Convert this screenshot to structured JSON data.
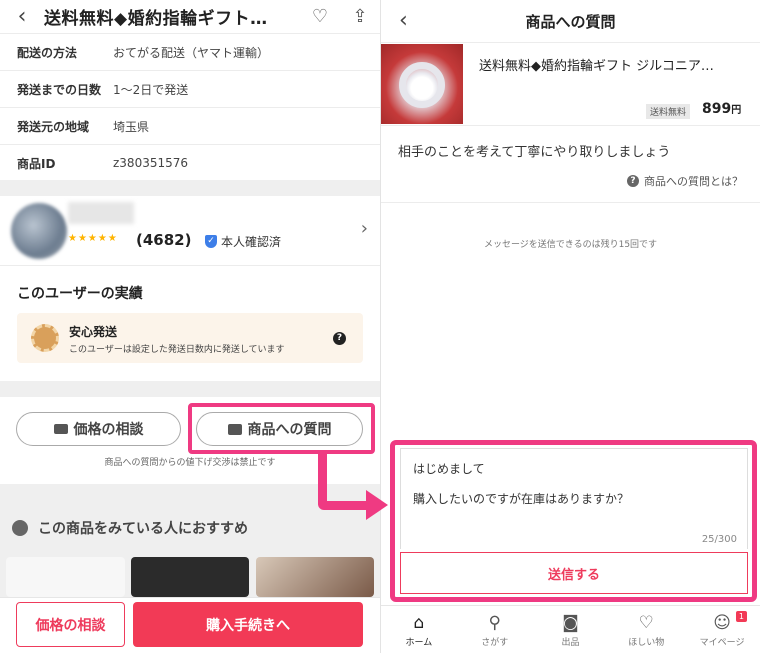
{
  "left": {
    "header_title": "送料無料◆婚約指輪ギフト…",
    "back_icon": "chevron-left-icon",
    "info_rows": [
      {
        "key": "配送の方法",
        "value": "おてがる配送（ヤマト運輸）"
      },
      {
        "key": "発送までの日数",
        "value": "1〜2日で発送"
      },
      {
        "key": "発送元の地域",
        "value": "埼玉県"
      },
      {
        "key": "商品ID",
        "value": "z380351576"
      }
    ],
    "seller": {
      "stars": "★★★★★",
      "rating_count": "(4682)",
      "verified": "本人確認済"
    },
    "performance": {
      "title": "このユーザーの実績",
      "main": "安心発送",
      "sub": "このユーザーは設定した発送日数内に発送しています"
    },
    "actions": {
      "price_negotiation": "価格の相談",
      "question": "商品への質問",
      "note": "商品への質問からの値下げ交渉は禁止です"
    },
    "recommend_title": "この商品をみている人におすすめ",
    "bottom": {
      "price_btn": "価格の相談",
      "buy_btn": "購入手続きへ"
    }
  },
  "right": {
    "header_title": "商品への質問",
    "product": {
      "title": "送料無料◆婚約指輪ギフト ジルコニア…",
      "shipping_badge": "送料無料",
      "price": "899",
      "price_unit": "円"
    },
    "guide": "相手のことを考えて丁寧にやり取りしましょう",
    "what_is": "商品への質問とは？",
    "remaining": "メッセージを送信できるのは残り15回です",
    "compose": {
      "line1": "はじめまして",
      "line2": "購入したいのですが在庫はありますか？",
      "counter": "25/300",
      "send": "送信する"
    },
    "tabs": [
      {
        "label": "ホーム",
        "icon": "home-icon"
      },
      {
        "label": "さがす",
        "icon": "search-icon"
      },
      {
        "label": "出品",
        "icon": "camera-icon"
      },
      {
        "label": "ほしい物",
        "icon": "heart-icon"
      },
      {
        "label": "マイページ",
        "icon": "user-icon",
        "badge": "1"
      }
    ]
  },
  "colors": {
    "accent": "#ef3a82",
    "brand": "#f23a56"
  }
}
